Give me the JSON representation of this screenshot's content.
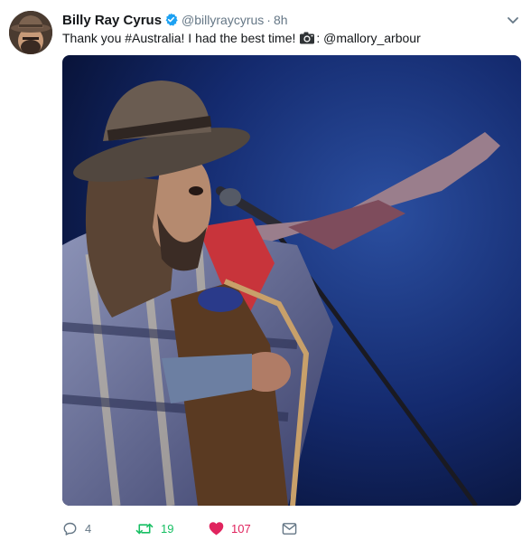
{
  "tweet": {
    "author_name": "Billy Ray Cyrus",
    "author_handle": "@billyraycyrus",
    "separator": "·",
    "time": "8h",
    "text_before": "Thank you #Australia! I had the best time!",
    "text_after": ": @mallory_arbour",
    "camera_icon": "camera-icon"
  },
  "actions": {
    "reply_count": "4",
    "retweet_count": "19",
    "like_count": "107"
  },
  "colors": {
    "verified": "#1da1f2",
    "retweet": "#17bf63",
    "like": "#e0245e",
    "muted": "#657786"
  }
}
